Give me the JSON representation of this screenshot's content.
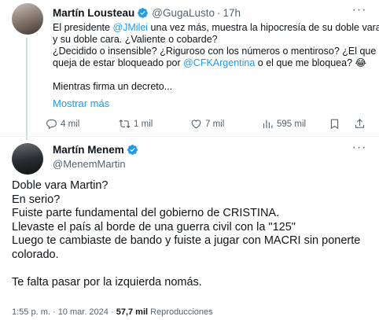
{
  "quoted_tweet": {
    "author_name": "Martín Lousteau",
    "handle": "@GugaLusto",
    "separator": "·",
    "time": "17h",
    "text_lines": [
      [
        {
          "t": "El presidente "
        },
        {
          "t": "@JMilei",
          "link": true
        },
        {
          "t": " una vez más, muestra la hipocresía de su doble vara..."
        }
      ],
      [
        {
          "t": "y su doble cara. ¿Valiente o cobarde?"
        }
      ],
      [
        {
          "t": "¿Decidido o insensible? ¿Riguroso con los números o mentiroso? ¿El que se"
        }
      ],
      [
        {
          "t": "queja de estar bloqueado por "
        },
        {
          "t": "@CFKArgentina",
          "link": true
        },
        {
          "t": " o el que me bloquea? 😂"
        }
      ],
      [
        {
          "t": ""
        }
      ],
      [
        {
          "t": "Mientras firma un decreto..."
        }
      ]
    ],
    "show_more": "Mostrar más",
    "actions": {
      "replies": "4 mil",
      "reposts": "1 mil",
      "likes": "7 mil",
      "views": "595 mil"
    }
  },
  "main_tweet": {
    "author_name": "Martín Menem",
    "handle": "@MenemMartin",
    "text_lines": [
      "Doble vara Martin?",
      "En serio?",
      "Fuiste parte fundamental del gobierno de CRISTINA.",
      "Llevaste el país al borde de una guerra civil con la \"125\"",
      "Luego te cambiaste de bando y fuiste a jugar con MACRI sin ponerte",
      "colorado.",
      "",
      "Te falta pasar por la izquierda nomás."
    ],
    "timestamp": "1:55 p. m. · 10 mar. 2024",
    "separator": "·",
    "views_count": "57,7 mil",
    "views_label": "Reproducciones"
  },
  "colors": {
    "accent": "#1d9bf0",
    "secondary_text": "#536471",
    "primary_text": "#0f1419",
    "divider": "#eff3f4"
  },
  "icons": [
    "verified-badge-icon",
    "more-options-icon",
    "reply-icon",
    "repost-icon",
    "like-icon",
    "views-icon",
    "bookmark-icon",
    "share-icon"
  ]
}
